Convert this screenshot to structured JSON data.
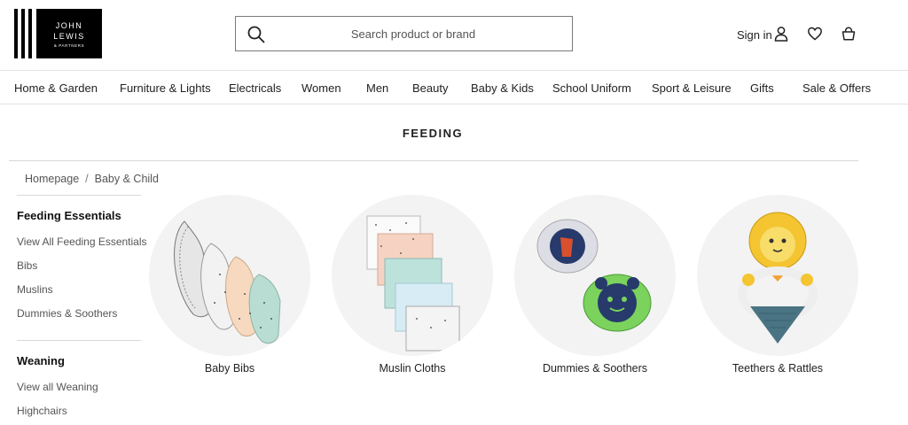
{
  "header": {
    "logo_line1": "JOHN",
    "logo_line2": "LEWIS",
    "logo_line3": "& PARTNERS",
    "search_placeholder": "Search product or brand",
    "sign_in": "Sign in"
  },
  "nav": [
    "Home & Garden",
    "Furniture & Lights",
    "Electricals",
    "Women",
    "Men",
    "Beauty",
    "Baby & Kids",
    "School Uniform",
    "Sport & Leisure",
    "Gifts",
    "Sale & Offers"
  ],
  "page": {
    "title": "FEEDING"
  },
  "breadcrumb": {
    "items": [
      "Homepage",
      "Baby & Child"
    ],
    "separator": "/"
  },
  "sidebar": {
    "sections": [
      {
        "heading": "Feeding Essentials",
        "links": [
          "View All Feeding Essentials",
          "Bibs",
          "Muslins",
          "Dummies & Soothers"
        ]
      },
      {
        "heading": "Weaning",
        "links": [
          "View all Weaning",
          "Highchairs"
        ]
      }
    ]
  },
  "categories": [
    "Baby Bibs",
    "Muslin Cloths",
    "Dummies & Soothers",
    "Teethers & Rattles"
  ],
  "icons": {
    "search": "search-icon",
    "account": "user-icon",
    "wishlist": "heart-icon",
    "basket": "basket-icon"
  }
}
